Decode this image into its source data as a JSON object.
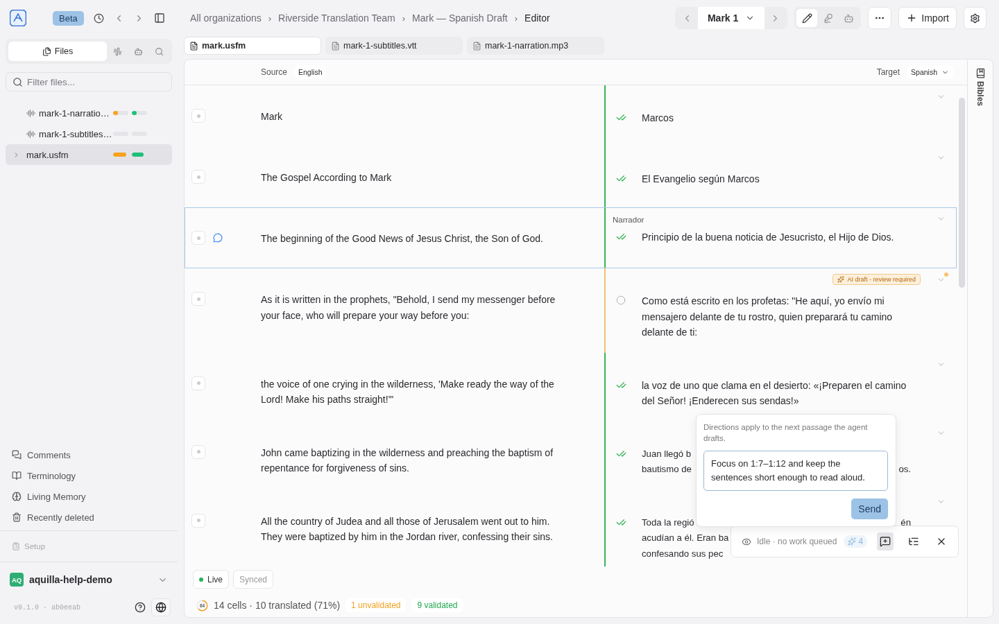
{
  "topbar": {
    "beta": "Beta",
    "breadcrumbs": [
      {
        "label": "All organizations"
      },
      {
        "separator": "›",
        "label": "Riverside Translation Team"
      },
      {
        "separator": "›",
        "label": "Mark — Spanish Draft"
      },
      {
        "separator": "›",
        "label": "Editor"
      }
    ],
    "chapter": "Mark 1",
    "modes": [
      {
        "kind": "edit",
        "selected": true
      },
      {
        "kind": "record",
        "selected": false
      },
      {
        "kind": "agent",
        "selected": false
      }
    ],
    "import": "Import"
  },
  "sidebar": {
    "tabs": [
      {
        "kind": "files",
        "label": "Files",
        "selected": true
      },
      {
        "kind": "audio",
        "selected": false
      },
      {
        "kind": "agent",
        "selected": false
      },
      {
        "kind": "search",
        "selected": false
      }
    ],
    "filter_placeholder": "Filter files...",
    "files": [
      {
        "kind": "audio",
        "name": "mark-1-narratio…",
        "selected": false,
        "progress": [
          {
            "kind": "unvalidated",
            "level": 0.3
          },
          {
            "kind": "validated",
            "level": 0.3
          }
        ]
      },
      {
        "kind": "audio",
        "name": "mark-1-subtitles…",
        "selected": false,
        "progress": [
          {
            "kind": "unvalidated",
            "level": 0
          },
          {
            "kind": "validated",
            "level": 0
          }
        ]
      },
      {
        "kind": "document",
        "name": "mark.usfm",
        "selected": true,
        "progress": [
          {
            "kind": "unvalidated",
            "level": 0.85
          },
          {
            "kind": "validated",
            "level": 0.75
          }
        ]
      }
    ],
    "nav": [
      {
        "kind": "comments",
        "label": "Comments"
      },
      {
        "kind": "terminology",
        "label": "Terminology"
      },
      {
        "kind": "memory",
        "label": "Living Memory"
      },
      {
        "kind": "deleted",
        "label": "Recently deleted"
      }
    ],
    "setup": {
      "label": "Setup",
      "disabled": true
    },
    "workspace": {
      "initials": "AQ",
      "name": "aquilla-help-demo"
    },
    "version": "v0.1.0 · ab0eeab"
  },
  "tabs": [
    {
      "label": "mark.usfm",
      "selected": true
    },
    {
      "label": "mark-1-subtitles.vtt",
      "selected": false
    },
    {
      "label": "mark-1-narration.mp3",
      "selected": false
    }
  ],
  "editor": {
    "source_label": "Source",
    "source_language": "English",
    "target_label": "Target",
    "target_language": "Spanish",
    "rows": [
      {
        "source": "Mark",
        "target": "Marcos",
        "validated": true,
        "selected": false,
        "commented": false
      },
      {
        "source": "The Gospel According to Mark",
        "target": "El Evangelio según Marcos",
        "validated": true,
        "selected": false,
        "commented": false
      },
      {
        "source": "The beginning of the Good News of Jesus Christ, the Son of God.",
        "speaker": "Narrador",
        "target": "Principio de la buena noticia de Jesucristo, el Hijo de Dios.",
        "validated": true,
        "selected": true,
        "commented": true
      },
      {
        "source": "As it is written in the prophets, \"Behold, I send my messenger before your face, who will prepare your way before you:",
        "badge": "AI draft - review required",
        "target": "Como está escrito en los profetas: \"He aquí, yo envío mi mensajero delante de tu rostro, quien preparará tu camino delante de ti:",
        "validated": false,
        "selected": false,
        "commented": false
      },
      {
        "source": "the voice of one crying in the wilderness, 'Make ready the way of the Lord! Make his paths straight!'\"",
        "target": "la voz de uno que clama en el desierto: «¡Preparen el camino del Señor! ¡Enderecen sus sendas!»",
        "validated": true,
        "selected": false,
        "commented": false
      },
      {
        "source": "John came baptizing in the wilderness and preaching the baptism of repentance for forgiveness of sins.",
        "target_lines": [
          {
            "text": "Juan llegó b"
          },
          {
            "text": "bautismo de",
            "tail": "os."
          }
        ],
        "validated": true,
        "selected": false,
        "commented": false
      },
      {
        "source": "All the country of Judea and all those of Jerusalem went out to him. They were baptized by him in the Jordan river, confessing their sins.",
        "target_lines": [
          {
            "text": "Toda la regió",
            "tail": "én"
          },
          {
            "text": "acudían a él. Eran ba"
          },
          {
            "text": "confesando sus pec"
          }
        ],
        "validated": true,
        "selected": false,
        "commented": false
      }
    ],
    "chips": [
      {
        "kind": "live",
        "label": "Live"
      },
      {
        "kind": "synced",
        "label": "Synced"
      }
    ],
    "stats": {
      "ring": "64",
      "level": 0.64,
      "summary": "14 cells · 10 translated (71%)",
      "unvalidated": "1 unvalidated",
      "validated": "9 validated"
    }
  },
  "directions": {
    "note": "Directions apply to the next passage the agent drafts.",
    "value": "Focus on 1:7–1:12 and keep the sentences short enough to read aloud.",
    "send": "Send"
  },
  "agent_bar": {
    "status": "Idle · no work queued",
    "count": "4",
    "tools": [
      {
        "kind": "directions",
        "selected": true
      },
      {
        "kind": "queue",
        "selected": false
      }
    ]
  },
  "rail": {
    "label": "Bibles"
  }
}
